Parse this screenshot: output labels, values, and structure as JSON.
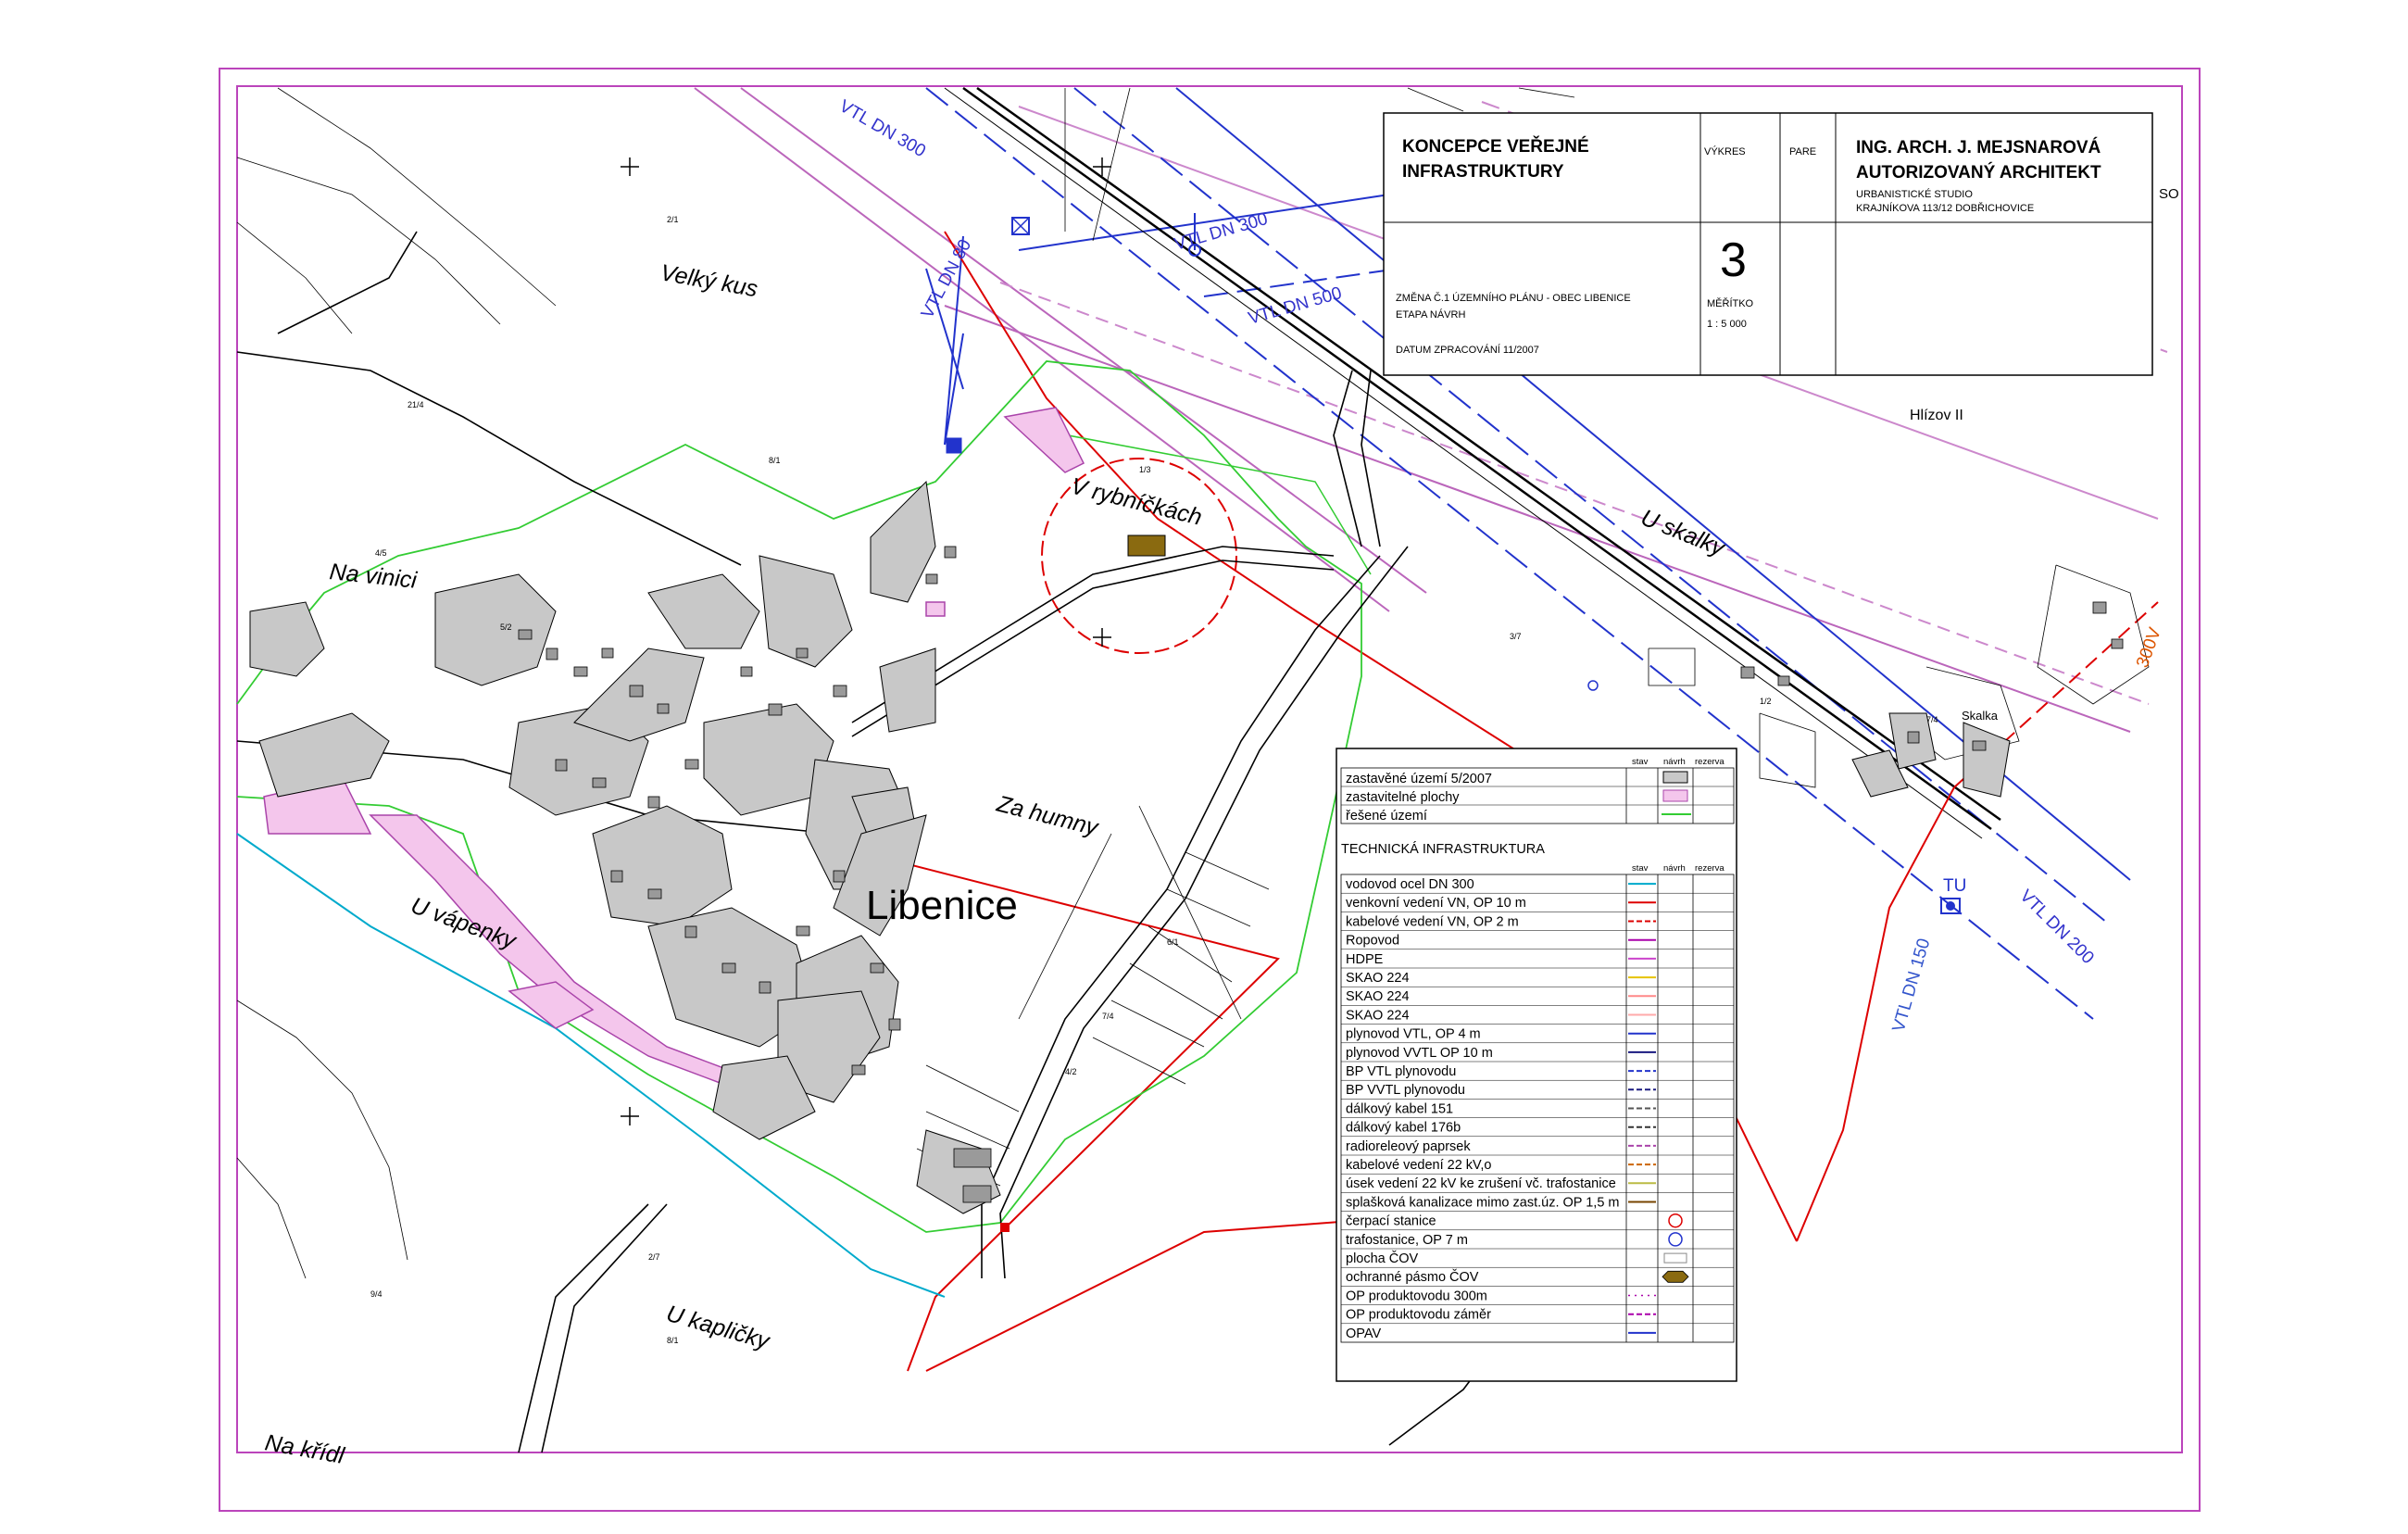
{
  "title_block": {
    "title_line1": "KONCEPCE VEŘEJNÉ",
    "title_line2": "INFRASTRUKTURY",
    "vykres_label": "VÝKRES",
    "pare_label": "PARE",
    "architect_line1": "ING. ARCH. J. MEJSNAROVÁ",
    "architect_line2": "AUTORIZOVANÝ ARCHITEKT",
    "studio_line1": "URBANISTICKÉ STUDIO",
    "studio_line2": "KRAJNÍKOVA 113/12 DOBŘICHOVICE",
    "change_line1": "ZMĚNA Č.1 ÚZEMNÍHO PLÁNU - OBEC LIBENICE",
    "change_line2": "ETAPA NÁVRH",
    "date_line": "DATUM ZPRACOVÁNÍ 11/2007",
    "sheet_number": "3",
    "scale_label": "MĚŘÍTKO",
    "scale_value": "1 : 5 000",
    "side_mark": "SO"
  },
  "place_names": {
    "velky_kus": "Velký kus",
    "na_vinici": "Na vinici",
    "v_rybnickach": "V rybníčkách",
    "u_skalky": "U skalky",
    "hlizov": "Hlízov II",
    "za_humny": "Za humny",
    "u_vapenky": "U vápenky",
    "libenice": "Libenice",
    "u_kaplicky": "U kapličky",
    "na_kridle": "Na křídl",
    "skalka": "Skalka"
  },
  "route_labels": {
    "vtl_300_top": "VTL DN 300",
    "vtl_300_mid": "VTL DN 300",
    "vtl_80": "VTL DN 80",
    "vtl_500": "VTL DN 500",
    "vtl_200": "VTL DN 200",
    "vtl_150": "VTL DN 150",
    "tu": "TU",
    "dn300_right": "300V"
  },
  "legend": {
    "col_stav": "stav",
    "col_navrh": "návrh",
    "col_rezerva": "rezerva",
    "top_rows": [
      {
        "label": "zastavěné území 5/2007",
        "symbol": "fill-gray"
      },
      {
        "label": "zastavitelné plochy",
        "symbol": "fill-pink"
      },
      {
        "label": "řešené území",
        "symbol": "line-green"
      }
    ],
    "section_title": "TECHNICKÁ INFRASTRUKTURA",
    "rows": [
      {
        "label": "vodovod ocel DN 300",
        "symbol": "line",
        "color": "#00aacc"
      },
      {
        "label": "venkovní vedení VN, OP 10 m",
        "symbol": "line",
        "color": "#dd0000"
      },
      {
        "label": "kabelové vedení VN, OP 2 m",
        "symbol": "dash",
        "color": "#dd0000"
      },
      {
        "label": "Ropovod",
        "symbol": "line",
        "color": "#aa00aa"
      },
      {
        "label": "HDPE",
        "symbol": "line",
        "color": "#cc44cc"
      },
      {
        "label": "SKAO 224",
        "symbol": "line",
        "color": "#e6c200"
      },
      {
        "label": "SKAO 224",
        "symbol": "line",
        "color": "#ff8888"
      },
      {
        "label": "SKAO 224",
        "symbol": "line",
        "color": "#ffaaaa"
      },
      {
        "label": "plynovod VTL, OP 4 m",
        "symbol": "line",
        "color": "#2233cc"
      },
      {
        "label": "plynovod VVTL OP 10 m",
        "symbol": "line",
        "color": "#1a1a80"
      },
      {
        "label": "BP VTL  plynovodu",
        "symbol": "dash",
        "color": "#2233cc"
      },
      {
        "label": "BP VVTL  plynovodu",
        "symbol": "dash",
        "color": "#1a1a80"
      },
      {
        "label": "dálkový kabel 151",
        "symbol": "dash",
        "color": "#555555"
      },
      {
        "label": "dálkový kabel 176b",
        "symbol": "dash",
        "color": "#333333"
      },
      {
        "label": "radioreleový paprsek",
        "symbol": "dash",
        "color": "#aa44aa"
      },
      {
        "label": "kabelové vedení 22 kV,o",
        "symbol": "dash",
        "color": "#cc6600"
      },
      {
        "label": "úsek vedení 22 kV ke zrušení vč. trafostanice",
        "symbol": "line",
        "color": "#bbbb44"
      },
      {
        "label": "splašková kanalizace mimo zast.úz. OP 1,5 m",
        "symbol": "line",
        "color": "#774400"
      },
      {
        "label": "čerpací stanice",
        "symbol": "circle",
        "color": "#dd0000"
      },
      {
        "label": "trafostanice, OP 7 m",
        "symbol": "circle",
        "color": "#2233cc"
      },
      {
        "label": "plocha ČOV",
        "symbol": "rect",
        "color": "#888888"
      },
      {
        "label": "ochranné pásmo ČOV",
        "symbol": "octagon",
        "color": "#8a6a10"
      },
      {
        "label": "OP produktovodu 300m",
        "symbol": "ticks",
        "color": "#aa00aa"
      },
      {
        "label": "OP produktovodu záměr",
        "symbol": "dash",
        "color": "#aa00aa"
      },
      {
        "label": "OPAV",
        "symbol": "line",
        "color": "#2233cc"
      }
    ]
  }
}
